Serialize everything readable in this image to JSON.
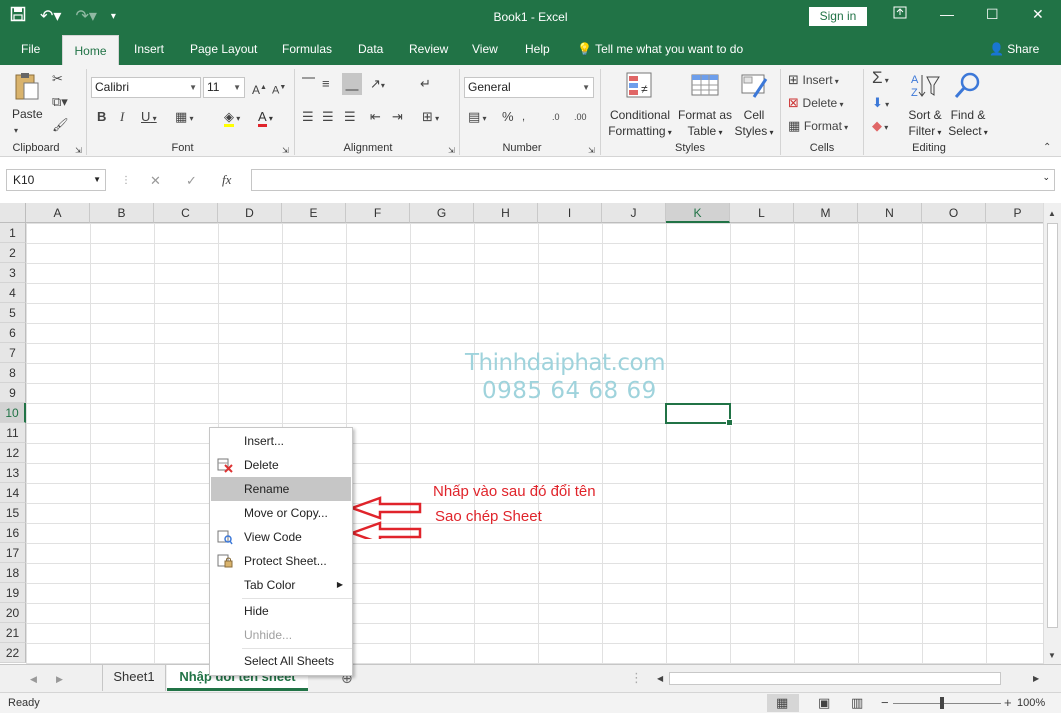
{
  "window": {
    "title": "Book1  -  Excel",
    "sign_in": "Sign in",
    "share": "Share"
  },
  "tabs": [
    "File",
    "Home",
    "Insert",
    "Page Layout",
    "Formulas",
    "Data",
    "Review",
    "View",
    "Help"
  ],
  "tell_me": "Tell me what you want to do",
  "ribbon": {
    "clipboard": {
      "label": "Clipboard",
      "paste": "Paste"
    },
    "font": {
      "label": "Font",
      "name": "Calibri",
      "size": "11"
    },
    "alignment": {
      "label": "Alignment"
    },
    "number": {
      "label": "Number",
      "format": "General"
    },
    "styles": {
      "label": "Styles",
      "conditional": [
        "Conditional",
        "Formatting"
      ],
      "format_table": [
        "Format as",
        "Table"
      ],
      "cell_styles": [
        "Cell",
        "Styles"
      ]
    },
    "cells": {
      "label": "Cells",
      "insert": "Insert",
      "delete": "Delete",
      "format": "Format"
    },
    "editing": {
      "label": "Editing",
      "sort": [
        "Sort &",
        "Filter"
      ],
      "find": [
        "Find &",
        "Select"
      ]
    }
  },
  "formula_bar": {
    "name_box": "K10",
    "value": ""
  },
  "columns": [
    "A",
    "B",
    "C",
    "D",
    "E",
    "F",
    "G",
    "H",
    "I",
    "J",
    "K",
    "L",
    "M",
    "N",
    "O",
    "P"
  ],
  "rows": [
    "1",
    "2",
    "3",
    "4",
    "5",
    "6",
    "7",
    "8",
    "9",
    "10",
    "11",
    "12",
    "13",
    "14",
    "15",
    "16",
    "17",
    "18",
    "19",
    "20",
    "21",
    "22"
  ],
  "active_column": "K",
  "active_row": "10",
  "watermark": {
    "line1": "Thinhdaiphat.com",
    "line2": "0985 64 68 69"
  },
  "annotations": {
    "rename_note": "Nhấp vào sau đó đổi tên",
    "copy_note": "Sao chép Sheet"
  },
  "context_menu": [
    {
      "label": "Insert...",
      "icon": "insert-icon"
    },
    {
      "label": "Delete",
      "icon": "delete-sheet-icon"
    },
    {
      "label": "Rename",
      "icon": "",
      "highlighted": true
    },
    {
      "label": "Move or Copy...",
      "icon": ""
    },
    {
      "label": "View Code",
      "icon": "view-code-icon"
    },
    {
      "label": "Protect Sheet...",
      "icon": "protect-sheet-icon"
    },
    {
      "label": "Tab Color",
      "icon": "",
      "submenu": true
    },
    {
      "label": "Hide",
      "icon": ""
    },
    {
      "label": "Unhide...",
      "icon": "",
      "disabled": true
    },
    {
      "label": "Select All Sheets",
      "icon": ""
    }
  ],
  "sheets": [
    "Sheet1",
    "Nhập đổi tên sheet"
  ],
  "status": {
    "ready": "Ready",
    "zoom": "100%"
  },
  "colors": {
    "accent": "#217346",
    "annotation": "#e0242b",
    "watermark": "#9fd3dc"
  }
}
